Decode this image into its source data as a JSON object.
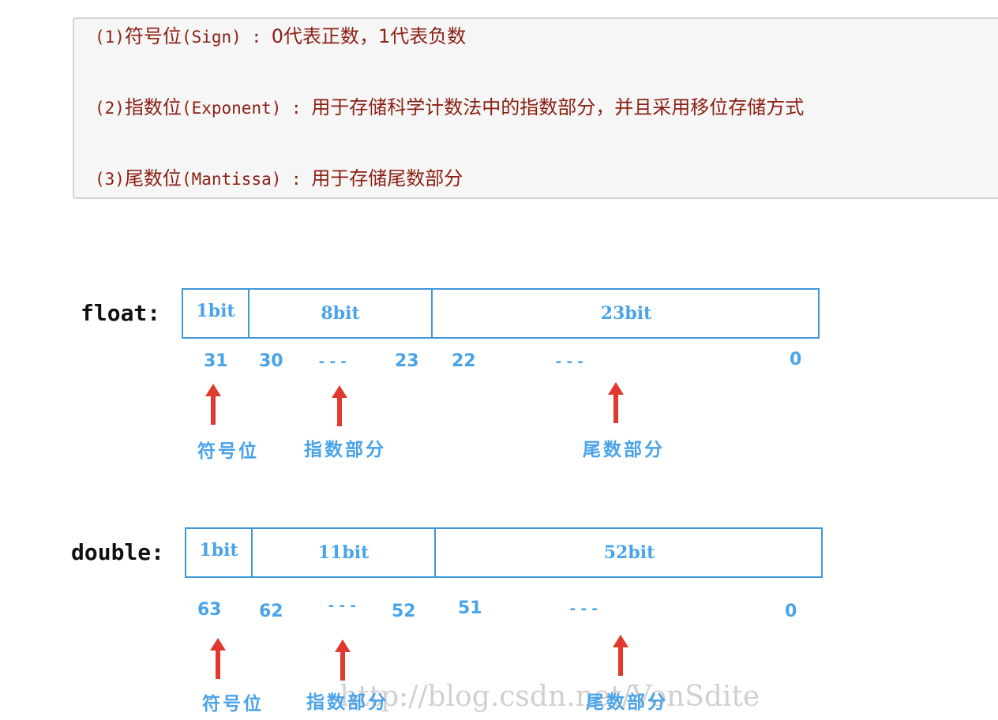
{
  "notes": [
    {
      "num": "(1)",
      "name": "符号位",
      "term": "(Sign)",
      "sep": " : ",
      "desc": "0代表正数，1代表负数"
    },
    {
      "num": "(2)",
      "name": "指数位",
      "term": "(Exponent)",
      "sep": " : ",
      "desc": "用于存储科学计数法中的指数部分，并且采用移位存储方式"
    },
    {
      "num": "(3)",
      "name": "尾数位",
      "term": "(Mantissa)",
      "sep": " : ",
      "desc": "用于存储尾数部分"
    }
  ],
  "float_layout": {
    "type": "float:",
    "segments": [
      "1bit",
      "8bit",
      "23bit"
    ],
    "indices": [
      "31",
      "30",
      "23",
      "22",
      "0"
    ],
    "dots": "---",
    "labels": [
      "符号位",
      "指数部分",
      "尾数部分"
    ]
  },
  "double_layout": {
    "type": "double:",
    "segments": [
      "1bit",
      "11bit",
      "52bit"
    ],
    "indices": [
      "63",
      "62",
      "52",
      "51",
      "0"
    ],
    "dots": "---",
    "labels": [
      "符号位",
      "指数部分",
      "尾数部分"
    ]
  },
  "watermark": "http://blog.csdn.net/VonSdite",
  "colors": {
    "note_text": "#8a1f12",
    "diagram_blue": "#4aa3e8",
    "arrow_red": "#e03a2e"
  }
}
